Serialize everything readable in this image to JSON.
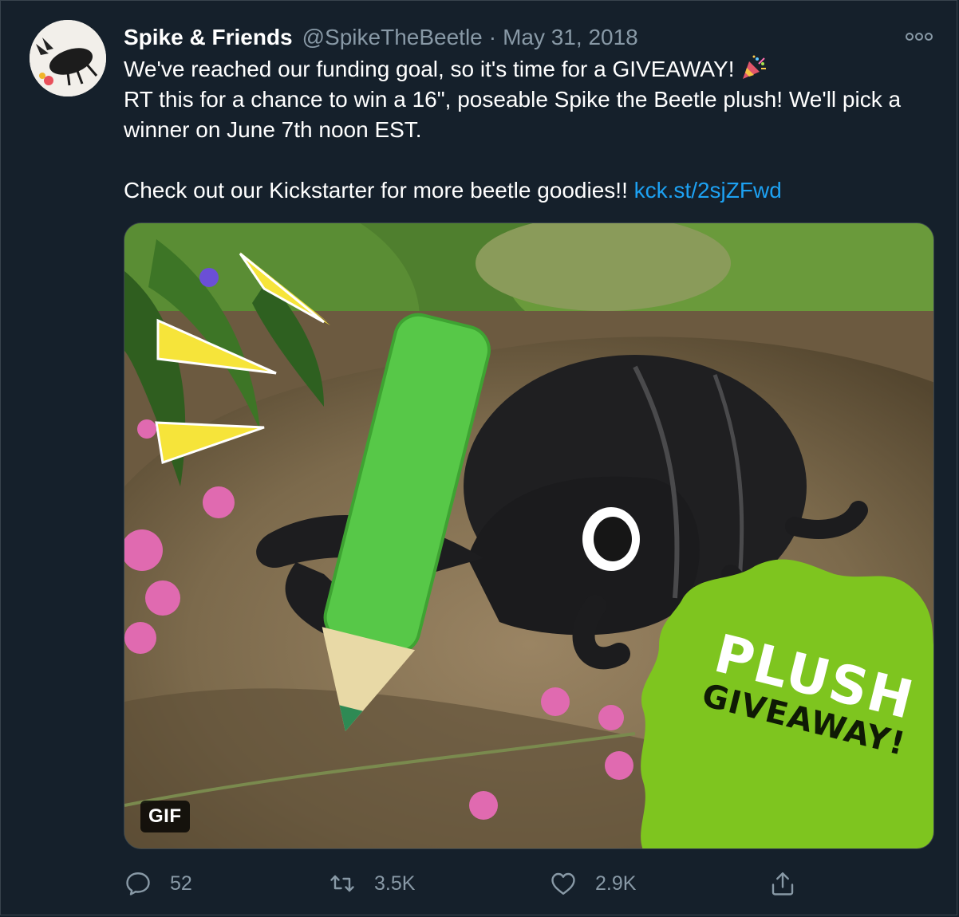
{
  "tweet": {
    "display_name": "Spike & Friends",
    "handle": "@SpikeTheBeetle",
    "separator": "·",
    "date": "May 31, 2018",
    "text_line1": "We've reached our funding goal, so it's time for a GIVEAWAY!",
    "text_line2": "RT this for a chance to win a 16\", poseable Spike the Beetle plush! We'll pick a winner on June 7th noon EST.",
    "text_line3": "Check out our Kickstarter for more beetle goodies!!",
    "link_text": "kck.st/2sjZFwd",
    "emoji_icon": "party-popper-icon"
  },
  "media": {
    "badge": "GIF",
    "sticker_line1": "PLUSH",
    "sticker_line2": "GIVEAWAY!",
    "sticker_color": "#7ec51f"
  },
  "actions": {
    "reply_count": "52",
    "retweet_count": "3.5K",
    "like_count": "2.9K"
  },
  "colors": {
    "background": "#15202b",
    "secondary_text": "#8899a6",
    "link": "#1da1f2",
    "border": "#38444d"
  }
}
